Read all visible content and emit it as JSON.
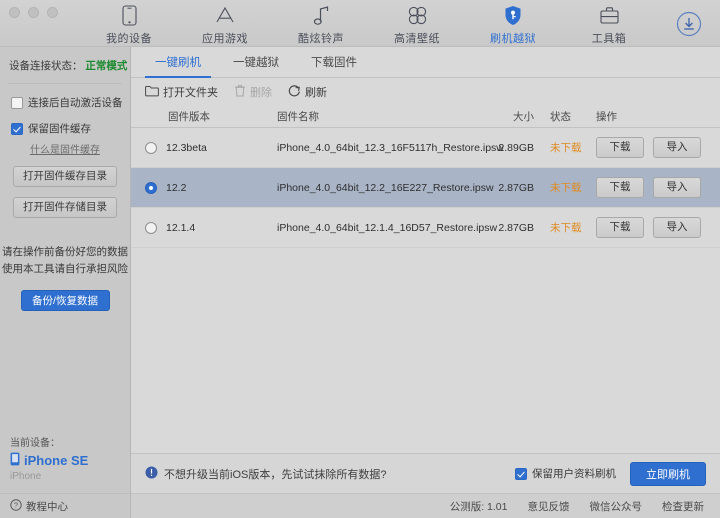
{
  "window": {
    "traffic_lights": [
      "close",
      "minimize",
      "zoom"
    ]
  },
  "toolbar": {
    "items": [
      {
        "label": "我的设备",
        "icon": "phone-icon",
        "active": false
      },
      {
        "label": "应用游戏",
        "icon": "appstore-icon",
        "active": false
      },
      {
        "label": "酷炫铃声",
        "icon": "music-note-icon",
        "active": false
      },
      {
        "label": "高清壁纸",
        "icon": "flower-icon",
        "active": false
      },
      {
        "label": "刷机越狱",
        "icon": "shield-key-icon",
        "active": true
      },
      {
        "label": "工具箱",
        "icon": "toolbox-icon",
        "active": false
      }
    ],
    "download_icon": "download-circle-icon"
  },
  "sidebar": {
    "status_label": "设备连接状态：",
    "status_value": "正常模式",
    "auto_activate": {
      "label": "连接后自动激活设备",
      "checked": false
    },
    "keep_cache": {
      "label": "保留固件缓存",
      "checked": true
    },
    "cache_help_link": "什么是固件缓存",
    "buttons": [
      "打开固件缓存目录",
      "打开固件存储目录"
    ],
    "warning_lines": [
      "请在操作前备份好您的数据",
      "使用本工具请自行承担风险"
    ],
    "backup_button": "备份/恢复数据",
    "device": {
      "label": "当前设备：",
      "name": "iPhone SE",
      "subtitle": "iPhone",
      "icon": "phone-small-icon"
    },
    "footer": {
      "label": "教程中心",
      "icon": "question-circle-icon"
    }
  },
  "main": {
    "tabs": [
      {
        "label": "一键刷机",
        "active": true
      },
      {
        "label": "一键越狱",
        "active": false
      },
      {
        "label": "下载固件",
        "active": false
      }
    ],
    "actions": [
      {
        "label": "打开文件夹",
        "icon": "folder-icon",
        "disabled": false
      },
      {
        "label": "删除",
        "icon": "trash-icon",
        "disabled": true
      },
      {
        "label": "刷新",
        "icon": "refresh-icon",
        "disabled": false
      }
    ],
    "table": {
      "columns": [
        "固件版本",
        "固件名称",
        "大小",
        "状态",
        "操作"
      ],
      "rows": [
        {
          "selected": false,
          "version": "12.3beta",
          "filename": "iPhone_4.0_64bit_12.3_16F5117h_Restore.ipsw",
          "size": "2.89GB",
          "state": "未下载",
          "download_button": "下载",
          "import_button": "导入"
        },
        {
          "selected": true,
          "version": "12.2",
          "filename": "iPhone_4.0_64bit_12.2_16E227_Restore.ipsw",
          "size": "2.87GB",
          "state": "未下载",
          "download_button": "下载",
          "import_button": "导入"
        },
        {
          "selected": false,
          "version": "12.1.4",
          "filename": "iPhone_4.0_64bit_12.1.4_16D57_Restore.ipsw",
          "size": "2.87GB",
          "state": "未下载",
          "download_button": "下载",
          "import_button": "导入"
        }
      ]
    },
    "bottom": {
      "hint_icon": "info-icon",
      "hint": "不想升级当前iOS版本，先试试抹除所有数据?",
      "keep_data": {
        "label": "保留用户资料刷机",
        "checked": true
      },
      "flash_button": "立即刷机"
    }
  },
  "statusbar": {
    "version": "公测版: 1.01",
    "feedback": "意见反馈",
    "wechat": "微信公众号",
    "update": "检查更新"
  },
  "colors": {
    "accent": "#2f6fd0",
    "status_ok": "#1c8a2e",
    "state_pending": "#e08a20",
    "selected_row": "#a9b4c6"
  }
}
